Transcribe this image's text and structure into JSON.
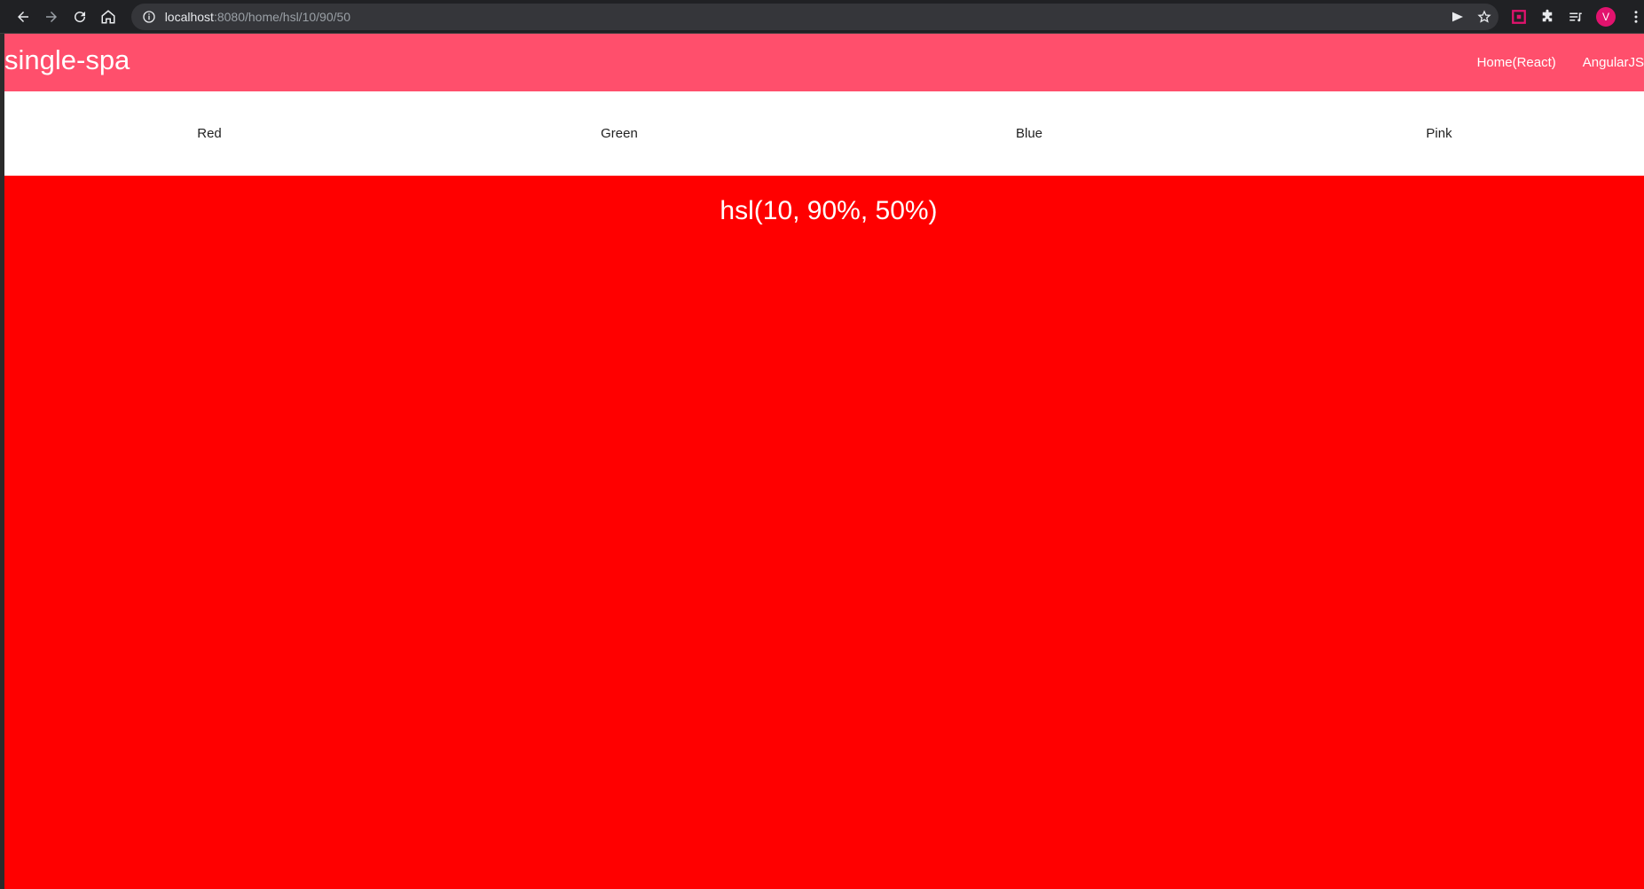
{
  "browser": {
    "url_host": "localhost",
    "url_rest": ":8080/home/hsl/10/90/50",
    "profile_initial": "V"
  },
  "header": {
    "brand": "single-spa",
    "nav": [
      "Home(React)",
      "AngularJS"
    ]
  },
  "tabs": [
    "Red",
    "Green",
    "Blue",
    "Pink"
  ],
  "main": {
    "color_text": "hsl(10, 90%, 50%)",
    "background": "#ff0000"
  },
  "colors": {
    "header_bg": "#ff4f6c",
    "avatar": "#e2136e"
  }
}
